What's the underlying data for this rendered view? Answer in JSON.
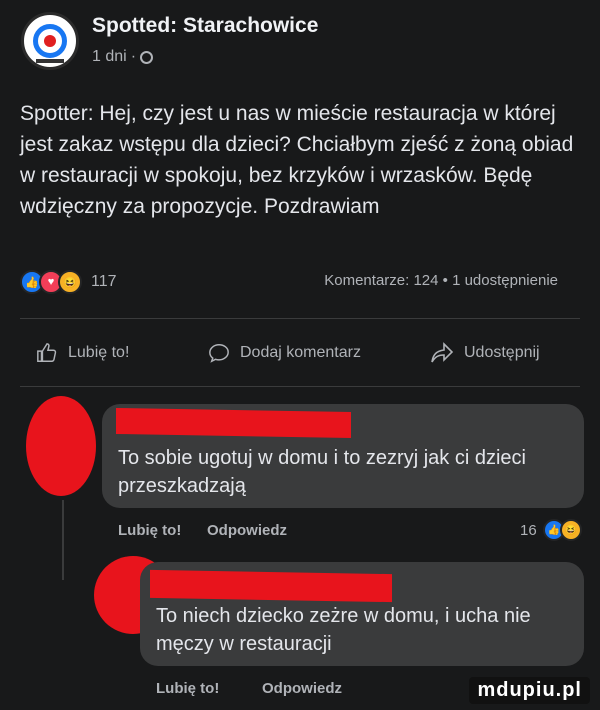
{
  "post": {
    "page_name": "Spotted: Starachowice",
    "time": "1 dni",
    "time_separator": "·",
    "text": "Spotter: Hej, czy jest u nas w mieście restauracja w której jest zakaz wstępu dla dzieci? Chciałbym zjeść z żoną obiad w restauracji w spokoju, bez krzyków i wrzasków. Będę wdzięczny za propozycje. Pozdrawiam",
    "reaction_count": "117",
    "stats": "Komentarze: 124 • 1 udostępnienie"
  },
  "actions": {
    "like": "Lubię to!",
    "comment": "Dodaj komentarz",
    "share": "Udostępnij"
  },
  "comments": [
    {
      "text": "To sobie ugotuj w domu i to zezryj jak ci dzieci przeszkadzają",
      "like": "Lubię to!",
      "reply": "Odpowiedz",
      "reaction_count": "16"
    },
    {
      "text": "To niech dziecko zeżre w domu, i ucha nie męczy w restauracji",
      "like": "Lubię to!",
      "reply": "Odpowiedz"
    }
  ],
  "watermark": "mdupiu.pl",
  "colors": {
    "accent": "#1877f2",
    "redaction": "#e8141c",
    "background": "#18191a"
  },
  "icons": [
    "spotted-logo-icon",
    "globe-icon",
    "like-icon",
    "love-icon",
    "haha-icon",
    "thumbs-up-outline-icon",
    "comment-bubble-icon",
    "share-arrow-icon"
  ]
}
